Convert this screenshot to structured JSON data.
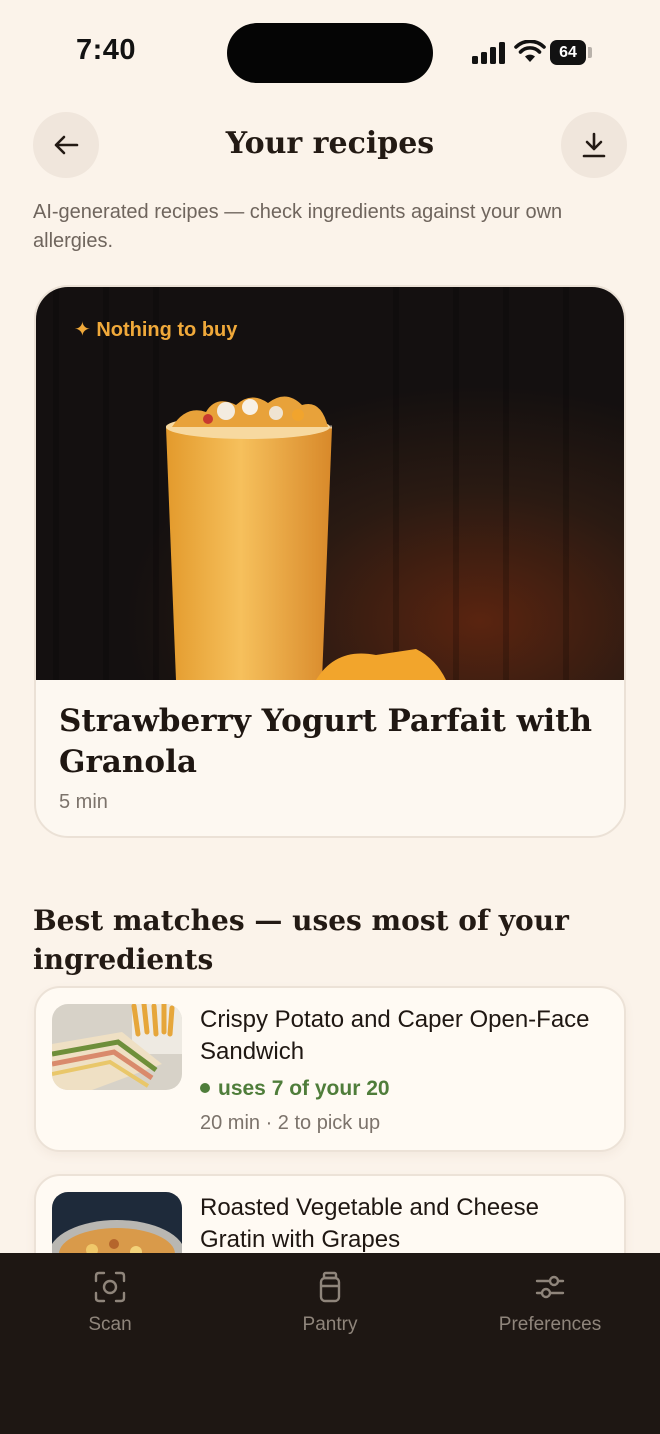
{
  "status_bar": {
    "time": "7:40",
    "battery": "64"
  },
  "header": {
    "title": "Your recipes"
  },
  "disclaimer": "AI-generated recipes — check ingredients against your own allergies.",
  "featured": {
    "badge": "✦ Nothing to buy",
    "title": "Strawberry Yogurt Parfait with Granola",
    "meta": "5 min"
  },
  "section": {
    "title": "Best matches — uses most of your ingredients"
  },
  "recipes": [
    {
      "title": "Crispy Potato and Caper Open-Face Sandwich",
      "match": "uses 7 of your 20",
      "meta": "20 min · 2 to pick up"
    },
    {
      "title": "Roasted Vegetable and Cheese Gratin with Grapes"
    }
  ],
  "tabs": [
    {
      "label": "Scan",
      "icon": "scan-icon"
    },
    {
      "label": "Pantry",
      "icon": "jar-icon"
    },
    {
      "label": "Preferences",
      "icon": "sliders-icon"
    }
  ],
  "colors": {
    "background": "#fbf3ea",
    "badge": "#f0a93a",
    "match_green": "#4f7d3a",
    "tab_bar": "#1e1713"
  }
}
